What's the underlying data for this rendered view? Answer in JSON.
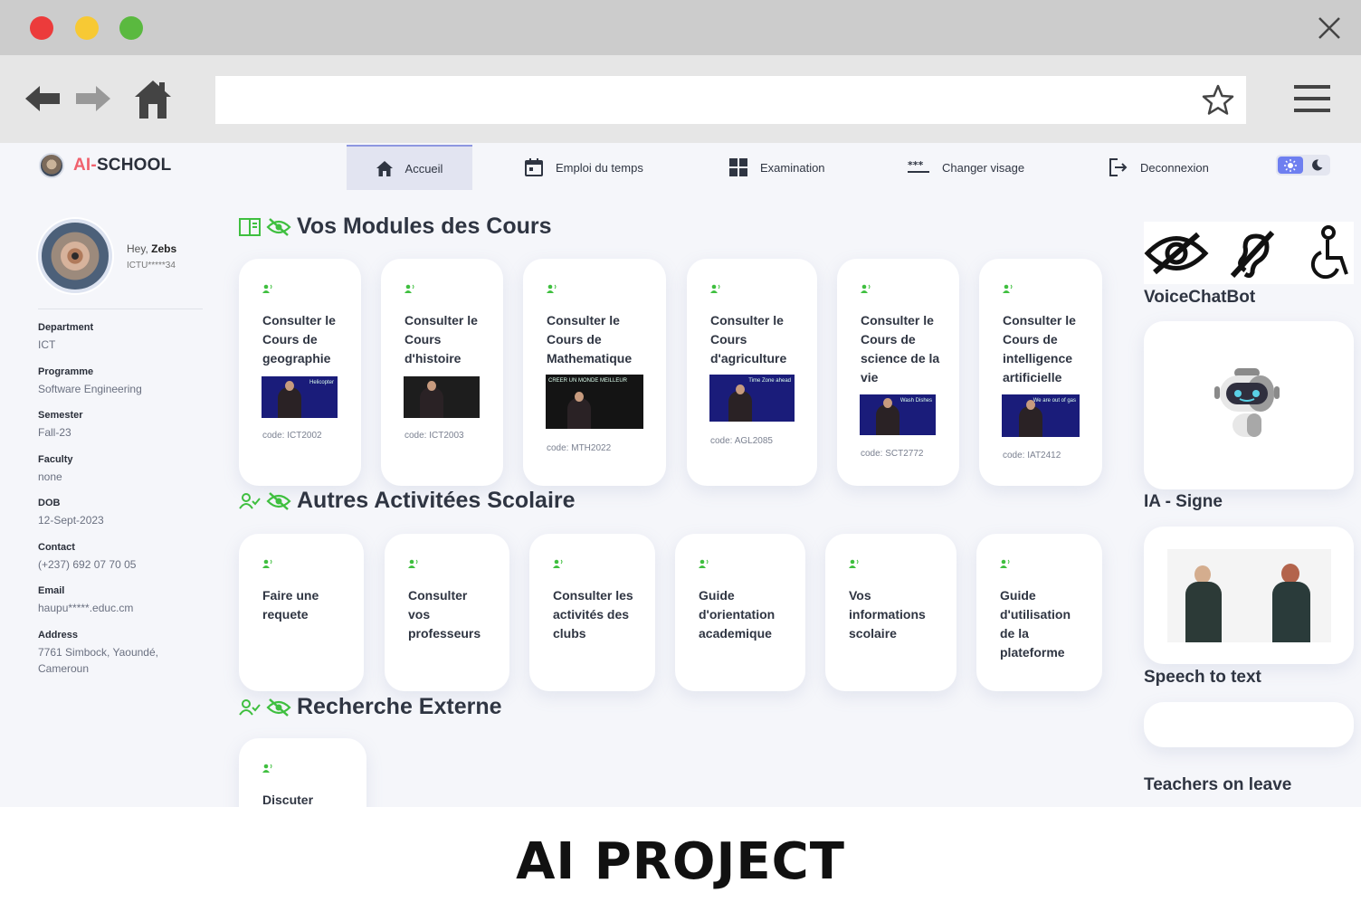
{
  "header": {
    "brand_prefix": "AI-",
    "brand_suffix": "SCHOOL",
    "nav": [
      {
        "label": "Accueil",
        "icon": "home-icon",
        "active": true
      },
      {
        "label": "Emploi du temps",
        "icon": "calendar-icon"
      },
      {
        "label": "Examination",
        "icon": "grid-icon"
      },
      {
        "label": "Changer visage",
        "icon": "password-icon"
      },
      {
        "label": "Deconnexion",
        "icon": "logout-icon"
      }
    ],
    "theme": {
      "light_icon": "sun-icon",
      "dark_icon": "moon-icon",
      "accent": "#6e7ff0"
    }
  },
  "profile": {
    "greeting": "Hey,",
    "name": "Zebs",
    "id": "ICTU*****34",
    "fields": [
      {
        "label": "Department",
        "value": "ICT"
      },
      {
        "label": "Programme",
        "value": "Software Engineering"
      },
      {
        "label": "Semester",
        "value": "Fall-23"
      },
      {
        "label": "Faculty",
        "value": "none"
      },
      {
        "label": "DOB",
        "value": "12-Sept-2023"
      },
      {
        "label": "Contact",
        "value": "(+237) 692 07 70 05"
      },
      {
        "label": "Email",
        "value": "haupu*****.educ.cm"
      },
      {
        "label": "Address",
        "value": "7761 Simbock, Yaoundé, Cameroun"
      }
    ]
  },
  "sections": {
    "modules_title": "Vos Modules des Cours",
    "activities_title": "Autres Activitées Scolaire",
    "external_title": "Recherche Externe"
  },
  "modules": [
    {
      "title": "Consulter le Cours de geographie",
      "code": "code: ICT2002",
      "thumb_caption": "Helicopter"
    },
    {
      "title": "Consulter le Cours d'histoire",
      "code": "code: ICT2003",
      "thumb_caption": ""
    },
    {
      "title": "Consulter le Cours de Mathematique",
      "code": "code: MTH2022",
      "thumb_caption": "CREER UN MONDE MEILLEUR"
    },
    {
      "title": "Consulter le Cours d'agriculture",
      "code": "code: AGL2085",
      "thumb_caption": "Time Zone ahead"
    },
    {
      "title": "Consulter le Cours de science de la vie",
      "code": "code: SCT2772",
      "thumb_caption": "Wash Dishes"
    },
    {
      "title": "Consulter le Cours de intelligence artificielle",
      "code": "code: IAT2412",
      "thumb_caption": "We are out of gas"
    }
  ],
  "activities": [
    {
      "title": "Faire une requete"
    },
    {
      "title": "Consulter vos professeurs"
    },
    {
      "title": "Consulter les activités des clubs"
    },
    {
      "title": "Guide d'orientation academique"
    },
    {
      "title": "Vos informations scolaire"
    },
    {
      "title": "Guide d'utilisation de la plateforme"
    }
  ],
  "external": [
    {
      "title": "Discuter"
    }
  ],
  "right": {
    "accessibility_icons": [
      "eye-slash-icon",
      "hearing-impaired-icon",
      "wheelchair-icon"
    ],
    "voice_chat_bot": "VoiceChatBot",
    "ia_signe": "IA - Signe",
    "speech_to_text": "Speech to text",
    "teachers_on_leave": "Teachers on leave"
  },
  "caption": "AI PROJECT",
  "colors": {
    "accent_green": "#3fbf3f",
    "brand_red": "#f0616d",
    "text_dark": "#2f3542"
  }
}
